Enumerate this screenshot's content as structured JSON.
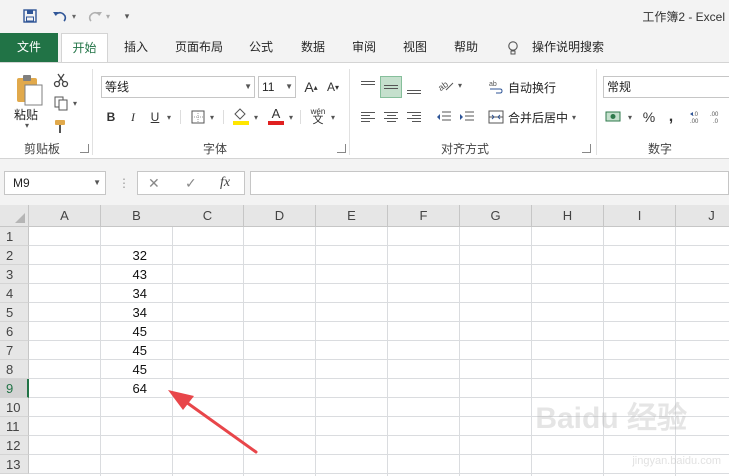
{
  "window": {
    "title": "工作簿2  -  Excel"
  },
  "tabs": {
    "file": "文件",
    "home": "开始",
    "insert": "插入",
    "page_layout": "页面布局",
    "formulas": "公式",
    "data": "数据",
    "review": "审阅",
    "view": "视图",
    "help": "帮助",
    "tell_me": "操作说明搜索"
  },
  "ribbon": {
    "clipboard": {
      "paste_label": "粘贴",
      "group_label": "剪贴板"
    },
    "font": {
      "font_name": "等线",
      "font_size": "11",
      "group_label": "字体",
      "bold": "B",
      "italic": "I",
      "underline": "U",
      "phonetic": "wén"
    },
    "alignment": {
      "wrap_text": "自动换行",
      "merge_center": "合并后居中",
      "group_label": "对齐方式"
    },
    "number": {
      "format": "常规",
      "percent": "%",
      "comma": ",",
      "group_label": "数字"
    }
  },
  "formula_bar": {
    "name_box": "M9",
    "fx": "fx",
    "formula": ""
  },
  "grid": {
    "columns": [
      "A",
      "B",
      "C",
      "D",
      "E",
      "F",
      "G",
      "H",
      "I",
      "J"
    ],
    "rows": [
      "1",
      "2",
      "3",
      "4",
      "5",
      "6",
      "7",
      "8",
      "9",
      "10",
      "11",
      "12",
      "13"
    ],
    "active_row": "9",
    "column_b_values": [
      "",
      "32",
      "43",
      "34",
      "34",
      "45",
      "45",
      "45",
      "64",
      "",
      "",
      "",
      ""
    ]
  },
  "colors": {
    "accent": "#217346",
    "arrow": "#e8464a"
  },
  "watermark": {
    "brand": "Baidu 经验",
    "url": "jingyan.baidu.com"
  }
}
